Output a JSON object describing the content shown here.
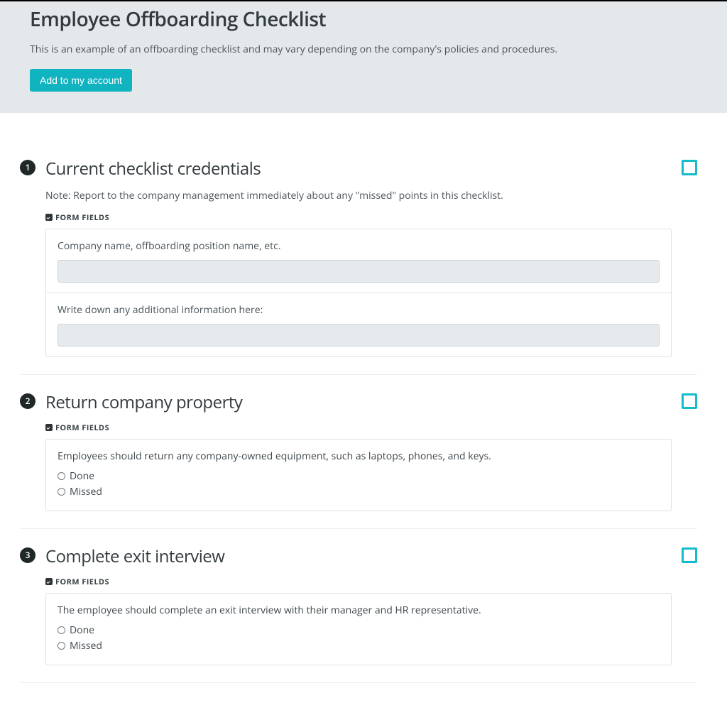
{
  "header": {
    "title": "Employee Offboarding Checklist",
    "description": "This is an example of an offboarding checklist and may vary depending on the company's policies and procedures.",
    "add_button": "Add to my account"
  },
  "form_fields_label": "FORM FIELDS",
  "steps": [
    {
      "num": "1",
      "title": "Current checklist credentials",
      "note": "Note: Report to the company management immediately about any \"missed\" points in this checklist.",
      "fields": [
        {
          "label": "Company name, offboarding position name, etc."
        },
        {
          "label": "Write down any additional information here:"
        }
      ]
    },
    {
      "num": "2",
      "title": "Return company property",
      "desc": "Employees should return any company-owned equipment, such as laptops, phones, and keys.",
      "options": [
        "Done",
        "Missed"
      ]
    },
    {
      "num": "3",
      "title": "Complete exit interview",
      "desc": "The employee should complete an exit interview with their manager and HR representative.",
      "options": [
        "Done",
        "Missed"
      ]
    }
  ]
}
